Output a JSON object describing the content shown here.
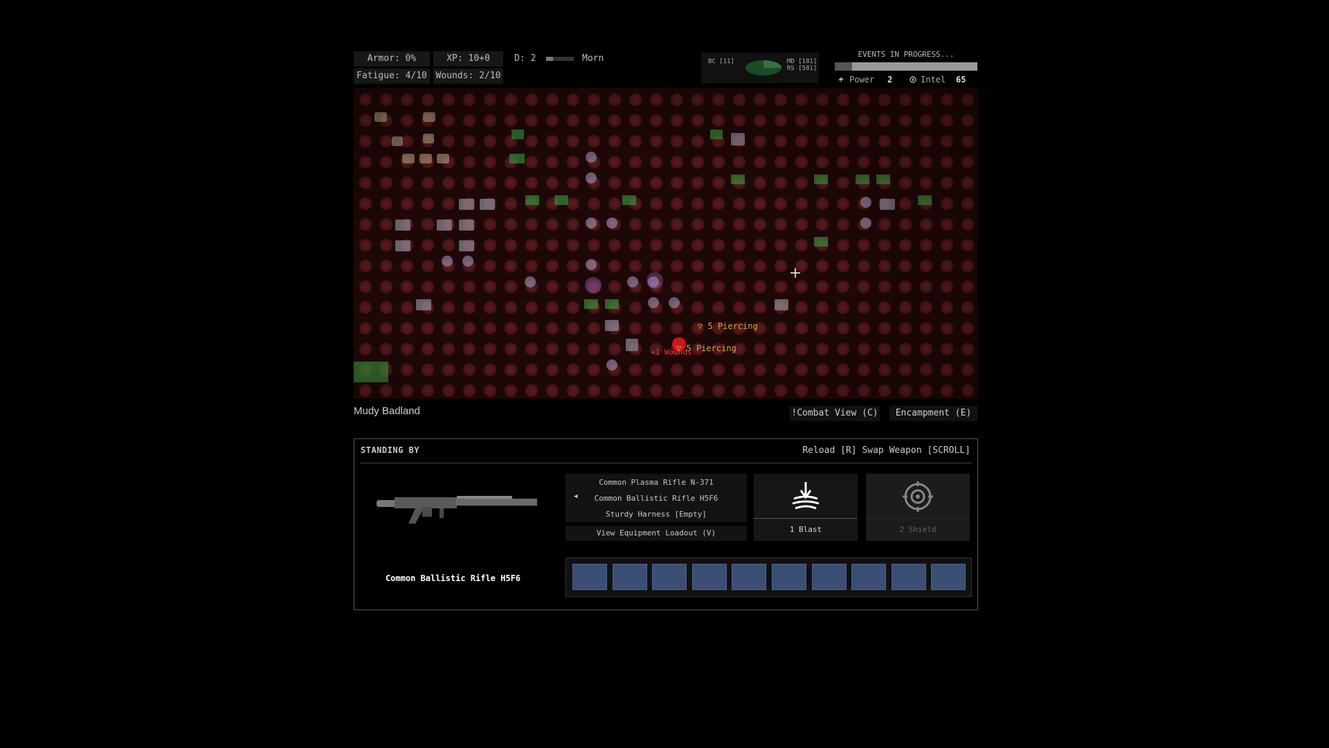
{
  "hud": {
    "armor": "Armor: 0%",
    "xp": "XP: 10+0",
    "day": "D: 2",
    "day_progress": 0.25,
    "time_of_day": "Morn",
    "fatigue": "Fatigue: 4/10",
    "wounds": "Wounds: 2/10"
  },
  "minimap": {
    "left_label": "BC [11]",
    "right_label_1": "MD [181]",
    "right_label_2": "RS [581]"
  },
  "events": {
    "title": "EVENTS IN PROGRESS...",
    "progress": 0.88,
    "power_label": "Power",
    "power_value": "2",
    "intel_label": "Intel",
    "intel_value": "65",
    "power_icon": "bolt-icon",
    "intel_icon": "intel-icon"
  },
  "map": {
    "combat_texts": [
      {
        "text": "▽ 5 Piercing"
      },
      {
        "text": "▽ 5 Piercing"
      },
      {
        "text": "+1 Wounds"
      }
    ]
  },
  "location": {
    "name": "Mudy Badland"
  },
  "view_buttons": {
    "combat_view": "!Combat View (C)",
    "encampment": "Encampment (E)"
  },
  "panel": {
    "status": "STANDING BY",
    "hotkeys": "Reload [R] Swap Weapon [SCROLL]",
    "weapon_name": "Common Ballistic Rifle H5F6",
    "weapon_list": [
      "Common Plasma Rifle N-371",
      "Common Ballistic Rifle H5F6",
      "Sturdy Harness [Empty]"
    ],
    "loadout_button": "View Equipment Loadout (V)",
    "abilities": [
      {
        "label": "1 Blast",
        "icon": "blast-icon"
      },
      {
        "label": "2 Shield",
        "icon": "shield-icon"
      }
    ],
    "slot_count": 10
  },
  "colors": {
    "map_bg": "#1e0707",
    "slot": "#3b4e73",
    "combat_text": "#d4a440"
  }
}
